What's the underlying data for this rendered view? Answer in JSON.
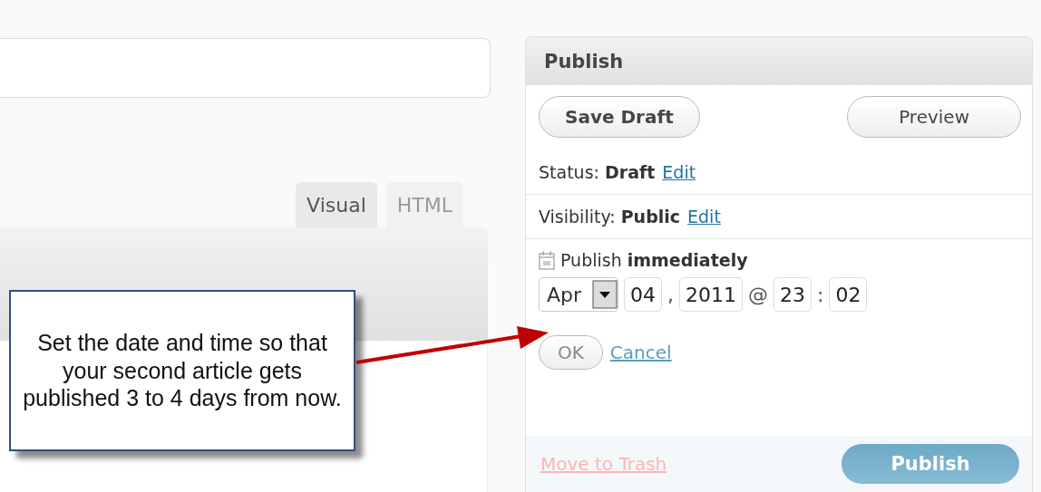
{
  "editor_tabs": [
    {
      "label": "Visual",
      "selected": true
    },
    {
      "label": "HTML",
      "selected": false
    }
  ],
  "publish_box": {
    "title": "Publish",
    "save_draft": "Save Draft",
    "preview": "Preview",
    "rows": [
      {
        "text": "Status: **Draft**",
        "link": "Edit"
      },
      {
        "text": "Visibility: **Public**",
        "link": "Edit"
      }
    ],
    "schedule": {
      "text": "Publish **immediately**",
      "month": "Apr",
      "day": "04",
      "comma": ",",
      "year": "2011",
      "at": "@",
      "hour": "23",
      "colon": ":",
      "minute": "02",
      "ok": "OK",
      "cancel": "Cancel"
    },
    "trash": "Move to Trash",
    "publish": "Publish"
  },
  "callout": "Set the date and time so that your second article gets published 3 to 4 days from now."
}
